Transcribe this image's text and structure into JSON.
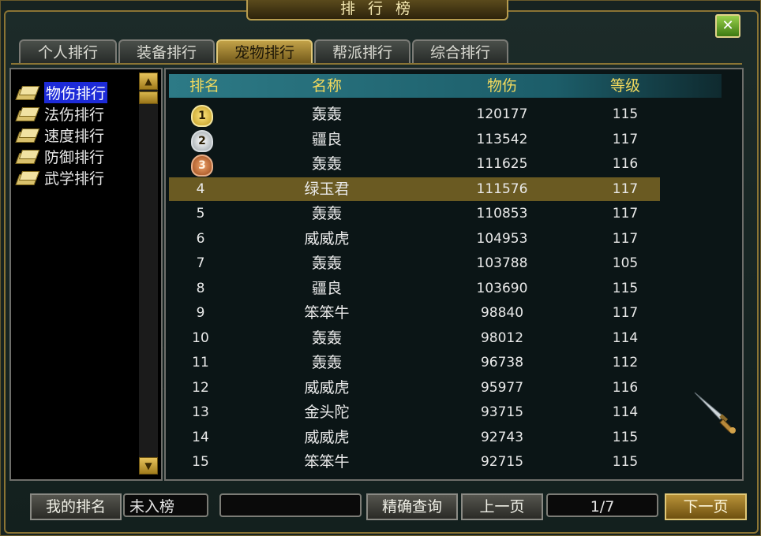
{
  "window": {
    "title": "排 行 榜",
    "close_label": "✕"
  },
  "tabs": [
    {
      "label": "个人排行",
      "active": false
    },
    {
      "label": "装备排行",
      "active": false
    },
    {
      "label": "宠物排行",
      "active": true
    },
    {
      "label": "帮派排行",
      "active": false
    },
    {
      "label": "综合排行",
      "active": false
    }
  ],
  "categories": [
    {
      "label": "物伤排行",
      "selected": true,
      "icon": "book-icon"
    },
    {
      "label": "法伤排行",
      "selected": false,
      "icon": "book-icon"
    },
    {
      "label": "速度排行",
      "selected": false,
      "icon": "book-icon"
    },
    {
      "label": "防御排行",
      "selected": false,
      "icon": "book-icon"
    },
    {
      "label": "武学排行",
      "selected": false,
      "icon": "book-icon"
    }
  ],
  "table": {
    "headers": [
      "排名",
      "名称",
      "物伤",
      "等级"
    ],
    "rows": [
      {
        "rank": "1",
        "medal": "gold",
        "name": "轰轰",
        "value": "120177",
        "level": "115"
      },
      {
        "rank": "2",
        "medal": "silver",
        "name": "疆良",
        "value": "113542",
        "level": "117"
      },
      {
        "rank": "3",
        "medal": "bronze",
        "name": "轰轰",
        "value": "111625",
        "level": "116"
      },
      {
        "rank": "4",
        "name": "绿玉君",
        "value": "111576",
        "level": "117",
        "highlight": true
      },
      {
        "rank": "5",
        "name": "轰轰",
        "value": "110853",
        "level": "117"
      },
      {
        "rank": "6",
        "name": "威威虎",
        "value": "104953",
        "level": "117"
      },
      {
        "rank": "7",
        "name": "轰轰",
        "value": "103788",
        "level": "105"
      },
      {
        "rank": "8",
        "name": "疆良",
        "value": "103690",
        "level": "115"
      },
      {
        "rank": "9",
        "name": "笨笨牛",
        "value": "98840",
        "level": "117"
      },
      {
        "rank": "10",
        "name": "轰轰",
        "value": "98012",
        "level": "114"
      },
      {
        "rank": "11",
        "name": "轰轰",
        "value": "96738",
        "level": "112"
      },
      {
        "rank": "12",
        "name": "威威虎",
        "value": "95977",
        "level": "116"
      },
      {
        "rank": "13",
        "name": "金头陀",
        "value": "93715",
        "level": "114"
      },
      {
        "rank": "14",
        "name": "威威虎",
        "value": "92743",
        "level": "115"
      },
      {
        "rank": "15",
        "name": "笨笨牛",
        "value": "92715",
        "level": "115"
      }
    ]
  },
  "footer": {
    "my_rank_button": "我的排名",
    "my_rank_value": "未入榜",
    "search_value": "",
    "exact_query_button": "精确查询",
    "prev_page_button": "上一页",
    "page_indicator": "1/7",
    "next_page_button": "下一页"
  },
  "colors": {
    "accent_gold": "#c2a248",
    "header_text": "#f3da5d",
    "header_bg": "#2d7a86",
    "highlight_row": "#6a5a22",
    "selected_category": "#1d2bd8"
  }
}
